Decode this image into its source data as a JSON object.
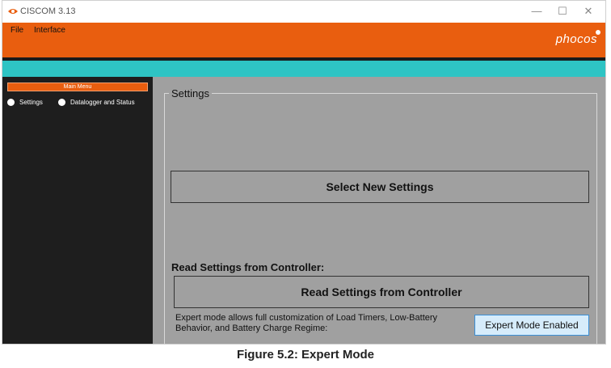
{
  "window": {
    "title": "CISCOM 3.13",
    "minimize": "—",
    "maximize": "☐",
    "close": "✕"
  },
  "menubar": {
    "items": [
      "File",
      "Interface"
    ],
    "logo": "phocos"
  },
  "sidebar": {
    "main_menu_label": "Main Menu",
    "options": [
      {
        "label": "Settings"
      },
      {
        "label": "Datalogger and Status"
      }
    ]
  },
  "settings": {
    "frame_title": "Settings",
    "select_new_button": "Select New Settings",
    "read_section_label": "Read Settings from Controller:",
    "read_button": "Read Settings from Controller",
    "expert_text": "Expert mode allows full customization of Load Timers, Low-Battery Behavior, and Battery Charge Regime:",
    "expert_button": "Expert Mode Enabled"
  },
  "caption": "Figure 5.2: Expert Mode",
  "colors": {
    "menubar": "#e95e0f",
    "teal_strip": "#2ec4c4",
    "sidebar": "#1e1e1e",
    "content": "#a0a0a0"
  }
}
